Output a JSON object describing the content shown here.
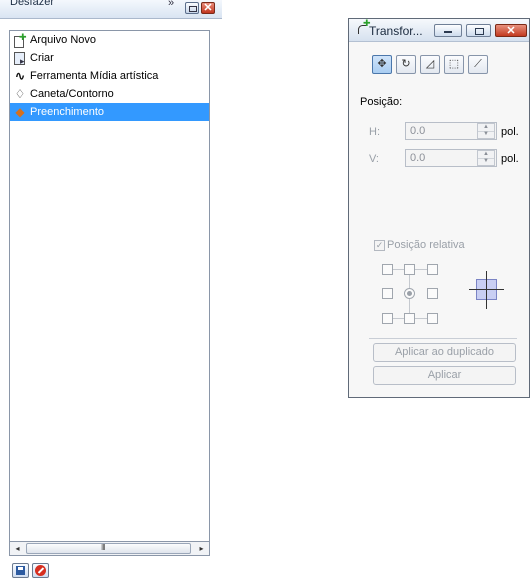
{
  "undo_docker": {
    "title": "Desfazer",
    "expand_glyph": "»",
    "close_glyph": "✕",
    "items": [
      {
        "label": "Arquivo Novo",
        "icon": "new-file-icon",
        "selected": false
      },
      {
        "label": "Criar",
        "icon": "create-icon",
        "selected": false
      },
      {
        "label": "Ferramenta Mídia artística",
        "icon": "artistic-media-icon",
        "selected": false
      },
      {
        "label": "Caneta/Contorno",
        "icon": "pen-outline-icon",
        "selected": false
      },
      {
        "label": "Preenchimento",
        "icon": "fill-icon",
        "selected": true
      }
    ],
    "scroll": {
      "left": "◂",
      "right": "▸",
      "grip": "III"
    }
  },
  "transform_docker": {
    "title": "Transfor...",
    "close_glyph": "✕",
    "tools": [
      {
        "name": "position",
        "glyph": "✥"
      },
      {
        "name": "rotate",
        "glyph": "↻"
      },
      {
        "name": "scale",
        "glyph": "◿"
      },
      {
        "name": "size",
        "glyph": "⬚"
      },
      {
        "name": "skew",
        "glyph": "⟋"
      }
    ],
    "position_label": "Posição:",
    "h_label": "H:",
    "v_label": "V:",
    "h_value": "0.0",
    "v_value": "0.0",
    "unit": "pol.",
    "relative_label": "Posição relativa",
    "relative_checked": true,
    "apply_duplicate_label": "Aplicar ao duplicado",
    "apply_label": "Aplicar"
  },
  "colors": {
    "selection": "#3399ff",
    "disabled_text": "#9aa0a8",
    "close_red": "#c23a20"
  }
}
